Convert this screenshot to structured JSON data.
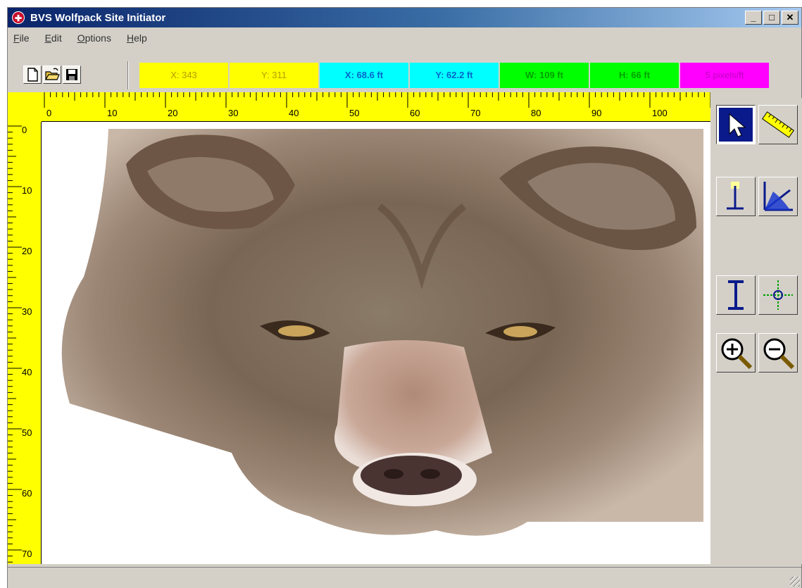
{
  "window": {
    "title": "BVS Wolfpack Site Initiator",
    "minimize": "_",
    "maximize": "□",
    "close": "✕"
  },
  "menu": [
    {
      "first": "F",
      "rest": "ile"
    },
    {
      "first": "E",
      "rest": "dit"
    },
    {
      "first": "O",
      "rest": "ptions"
    },
    {
      "first": "H",
      "rest": "elp"
    }
  ],
  "toolbar": {
    "new_icon": "new-document-icon",
    "open_icon": "open-folder-icon",
    "save_icon": "save-disk-icon"
  },
  "readouts": {
    "pixel_x": "X: 343",
    "pixel_y": "Y: 311",
    "feet_x": "X: 68.6 ft",
    "feet_y": "Y: 62.2 ft",
    "width": "W: 109 ft",
    "height": "H: 66 ft",
    "scale": "5 pixels/ft"
  },
  "rulers": {
    "horizontal": [
      "0",
      "10",
      "20",
      "30",
      "40",
      "50",
      "60",
      "70",
      "80",
      "90",
      "100"
    ],
    "vertical": [
      "0",
      "10",
      "20",
      "30",
      "40",
      "50",
      "60",
      "70"
    ]
  },
  "tools": {
    "select": "select-arrow-icon",
    "ruler": "ruler-icon",
    "pin": "pin-marker-icon",
    "angle": "angle-icon",
    "height": "height-i-beam-icon",
    "crosshair": "crosshair-icon",
    "zoom_in": "zoom-in-icon",
    "zoom_out": "zoom-out-icon"
  },
  "colors": {
    "ruler": "#ffff00",
    "cyan": "#00ffff",
    "green": "#00ff00",
    "magenta": "#ff00ff",
    "title_start": "#0a246a"
  }
}
